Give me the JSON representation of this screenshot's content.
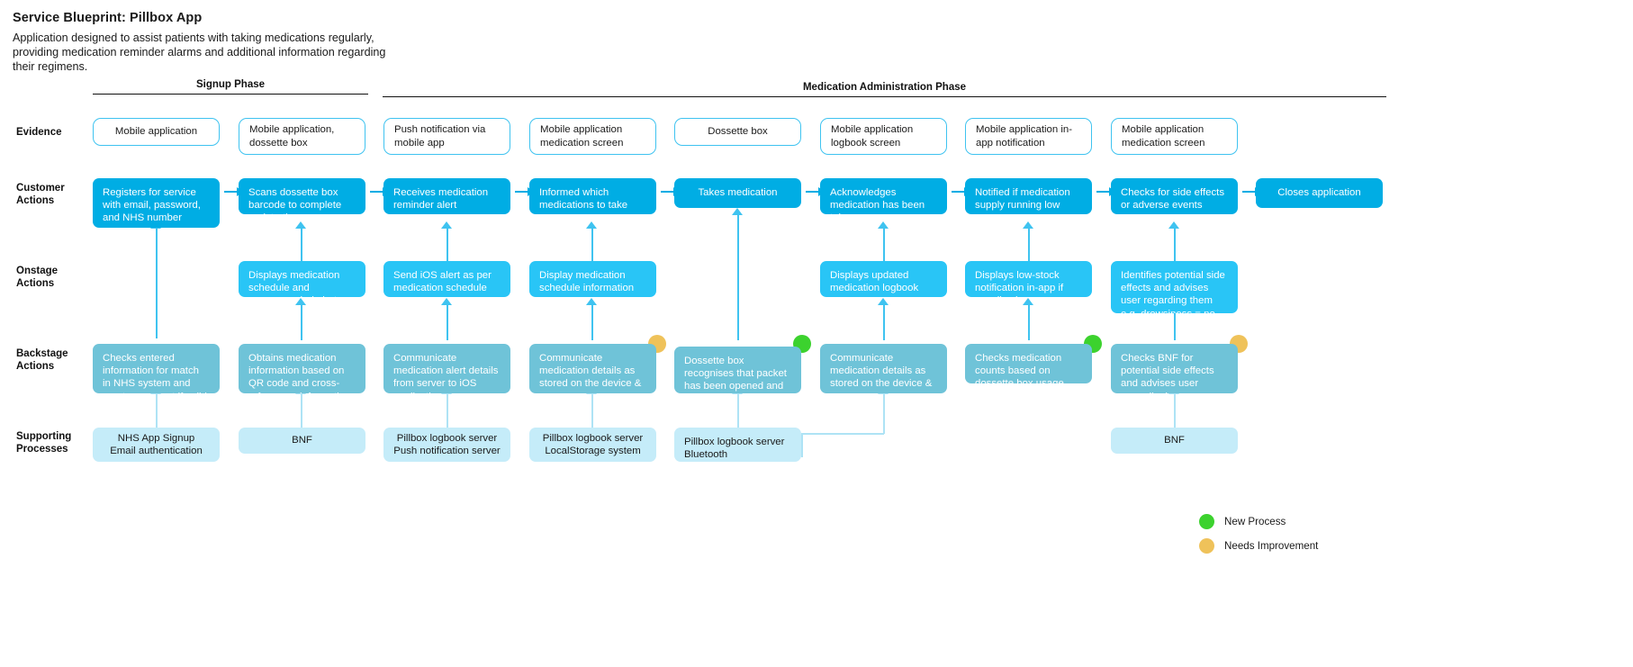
{
  "header": {
    "title": "Service Blueprint: Pillbox App",
    "description": "Application designed to assist patients with taking medications regularly, providing medication reminder alarms and additional information regarding their regimens."
  },
  "phases": [
    {
      "label": "Signup Phase"
    },
    {
      "label": "Medication Administration Phase"
    }
  ],
  "row_labels": {
    "evidence": "Evidence",
    "customer": "Customer\nActions",
    "customer_l1": "Customer",
    "customer_l2": "Actions",
    "onstage_l1": "Onstage",
    "onstage_l2": "Actions",
    "backstage_l1": "Backstage",
    "backstage_l2": "Actions",
    "support_l1": "Supporting",
    "support_l2": "Processes"
  },
  "evidence": [
    "Mobile application",
    "Mobile application, dossette box",
    "Push notification via mobile app",
    "Mobile application medication screen",
    "Dossette box",
    "Mobile application logbook screen",
    "Mobile application in-app notification",
    "Mobile application medication screen"
  ],
  "customer_actions": [
    "Registers for service with email, password, and NHS number",
    "Scans dossette box barcode to complete registration",
    "Receives medication reminder alert",
    "Informed which medications to take",
    "Takes medication",
    "Acknowledges medication has been taken",
    "Notified if medication supply running low",
    "Checks for side effects or adverse events",
    "Closes application"
  ],
  "onstage_actions": [
    "Displays medication schedule and recommended alerts",
    "Send iOS alert as per medication schedule",
    "Display medication schedule information",
    "Displays updated medication logbook",
    "Displays low-stock notification in-app if supplies low",
    "Identifies potential side effects and advises user regarding them e.g. drowsiness  = no driving"
  ],
  "backstage_actions": [
    "Checks entered information for match in NHS system and creates account if valid",
    "Obtains medication information based on QR code and cross-references information with BNF",
    "Communicate medication alert details from server to iOS application",
    "Communicate medication details as stored on the device & server",
    "Dossette box recognises that packet has been opened and sends alert to phone / server",
    "Communicate medication details as stored on the device & server",
    "Checks medication counts based on dossette box usage",
    "Checks BNF for potential side effects and advises user accordingly"
  ],
  "supporting_processes": [
    "NHS App Signup\nEmail authentication",
    "BNF",
    "Pillbox logbook server\nPush notification server",
    "Pillbox logbook server\nLocalStorage system",
    "Pillbox logbook server\nBluetooth",
    "BNF"
  ],
  "supporting_processes_lines": [
    [
      "NHS App Signup",
      "Email authentication"
    ],
    [
      "BNF"
    ],
    [
      "Pillbox logbook server",
      "Push notification server"
    ],
    [
      "Pillbox logbook server",
      "LocalStorage system"
    ],
    [
      "Pillbox logbook server",
      "Bluetooth"
    ],
    [
      "BNF"
    ]
  ],
  "legend": [
    {
      "label": "New Process",
      "color": "#3CD22E"
    },
    {
      "label": "Needs Improvement",
      "color": "#EFC25A"
    }
  ],
  "colors": {
    "customer": "#00ADE4",
    "onstage": "#29C5F6",
    "backstage": "#6FC3D8",
    "support": "#C5ECF9",
    "evidence_border": "#3FC3F0",
    "new_process": "#3CD22E",
    "needs_improvement": "#EFC25A"
  }
}
